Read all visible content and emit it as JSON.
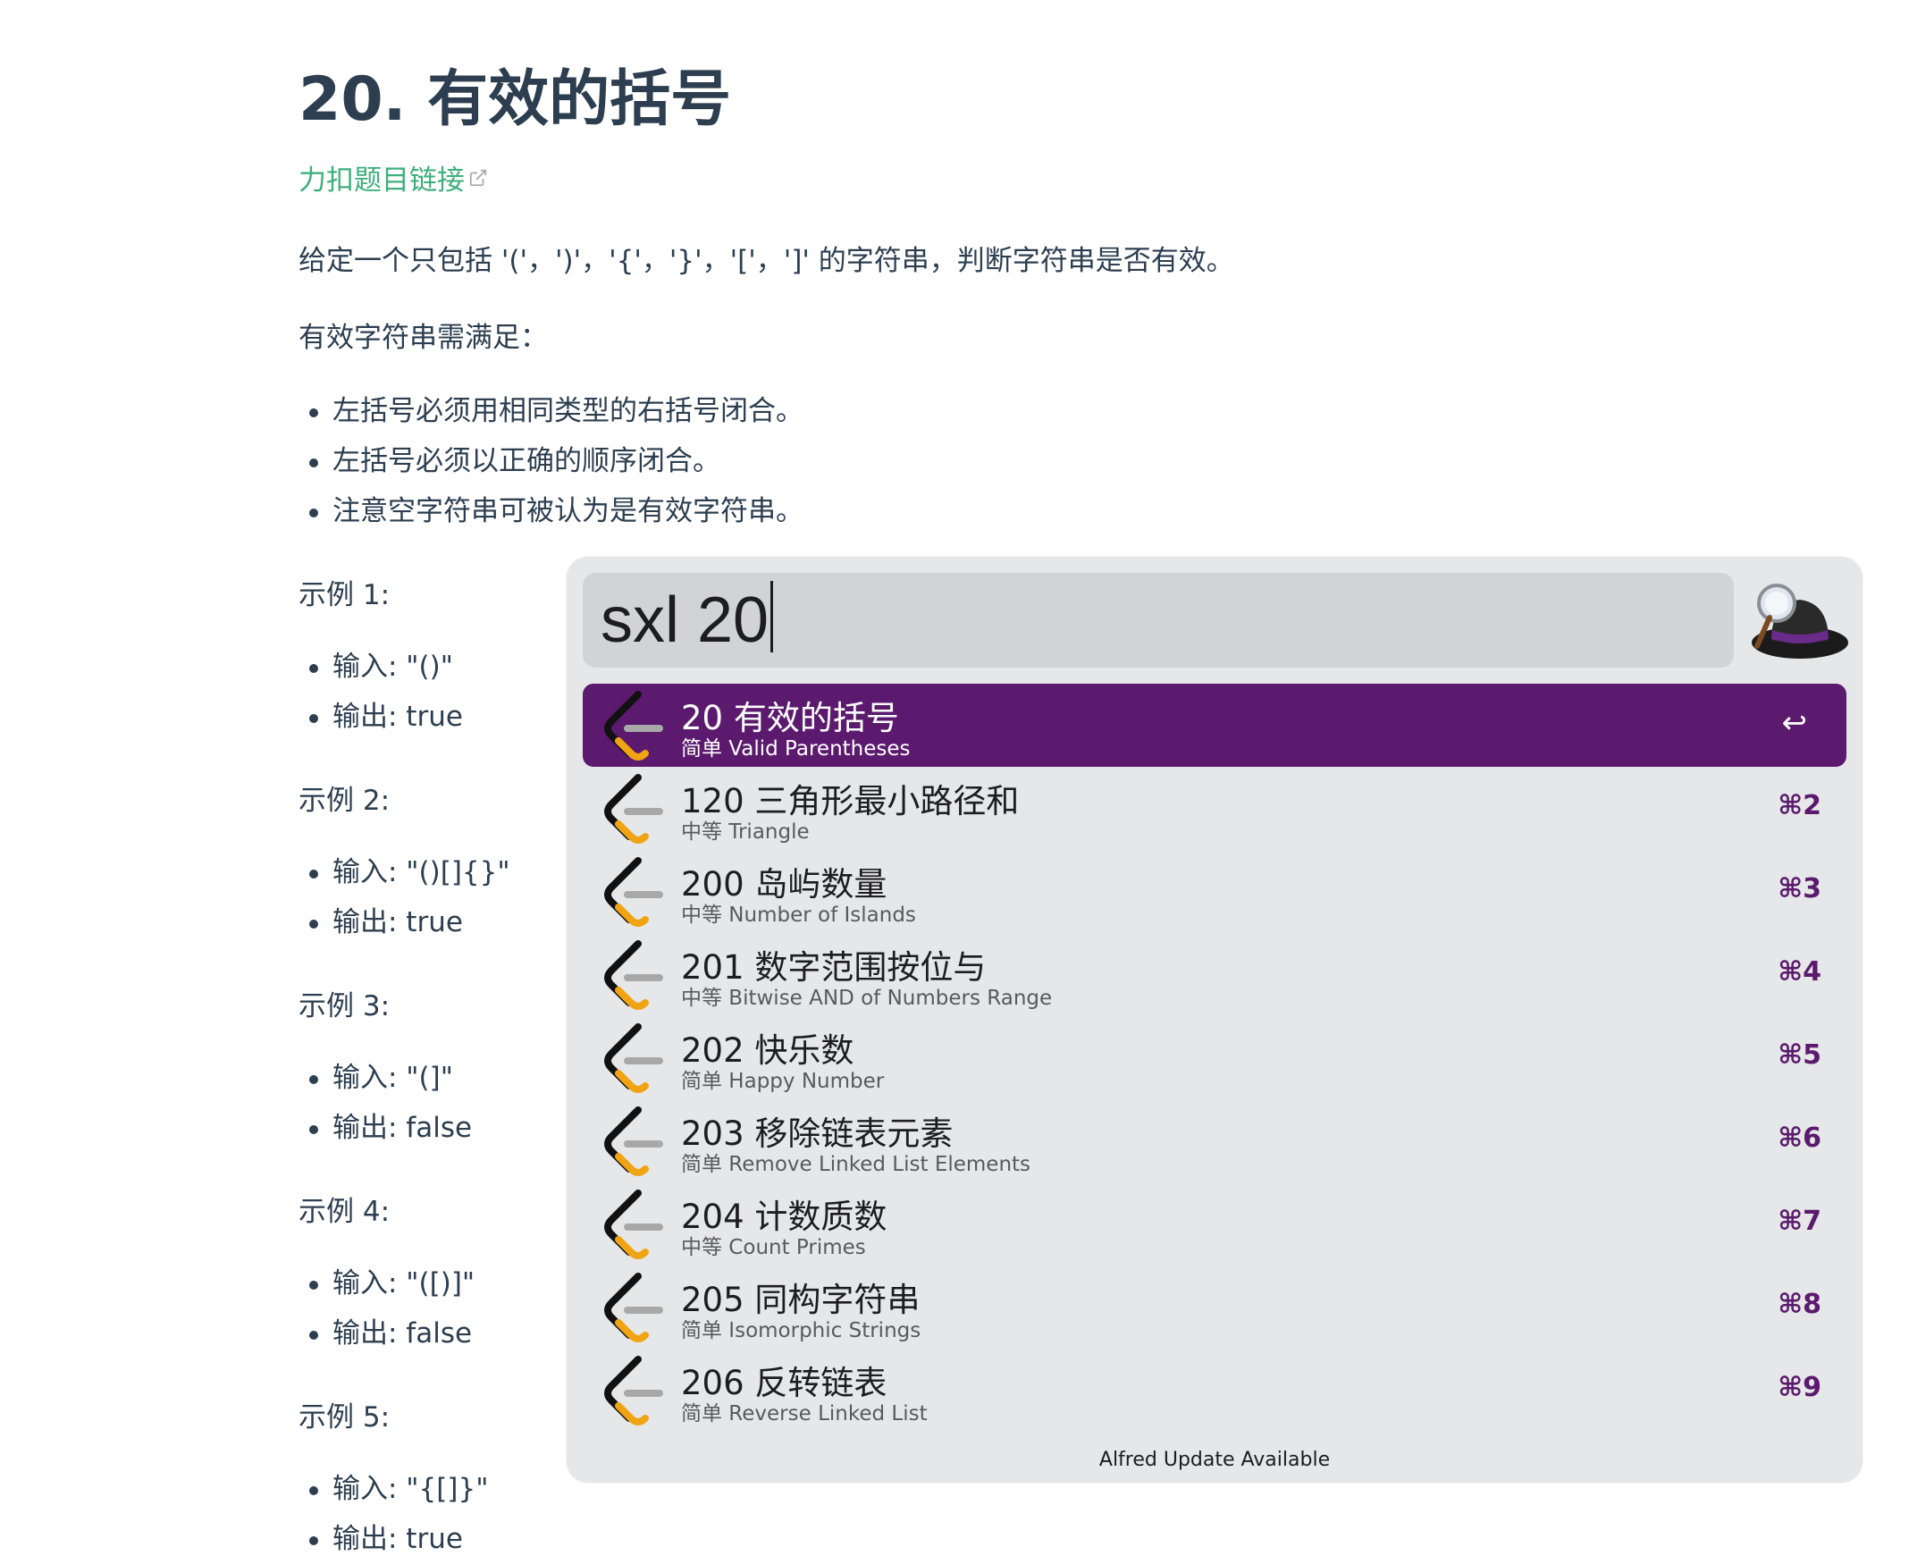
{
  "article": {
    "title": "20. 有效的括号",
    "link_text": "力扣题目链接",
    "description": "给定一个只包括 '('，')'，'{'，'}'，'['，']' 的字符串，判断字符串是否有效。",
    "requirement_intro": "有效字符串需满足：",
    "rules": [
      "左括号必须用相同类型的右括号闭合。",
      "左括号必须以正确的顺序闭合。",
      "注意空字符串可被认为是有效字符串。"
    ],
    "examples": [
      {
        "label": "示例 1:",
        "input": "输入: \"()\"",
        "output": "输出: true"
      },
      {
        "label": "示例 2:",
        "input": "输入: \"()[]{}\"",
        "output": "输出: true"
      },
      {
        "label": "示例 3:",
        "input": "输入: \"(]\"",
        "output": "输出: false"
      },
      {
        "label": "示例 4:",
        "input": "输入: \"([)]\"",
        "output": "输出: false"
      },
      {
        "label": "示例 5:",
        "input": "输入: \"{[]}\"",
        "output": "输出: true"
      }
    ]
  },
  "alfred": {
    "query": "sxl 20",
    "results": [
      {
        "title": "20 有效的括号",
        "subtitle": "简单 Valid Parentheses",
        "shortcut": "↩",
        "selected": true
      },
      {
        "title": "120 三角形最小路径和",
        "subtitle": "中等 Triangle",
        "shortcut": "⌘2"
      },
      {
        "title": "200 岛屿数量",
        "subtitle": "中等 Number of Islands",
        "shortcut": "⌘3"
      },
      {
        "title": "201 数字范围按位与",
        "subtitle": "中等 Bitwise AND of Numbers Range",
        "shortcut": "⌘4"
      },
      {
        "title": "202 快乐数",
        "subtitle": "简单 Happy Number",
        "shortcut": "⌘5"
      },
      {
        "title": "203 移除链表元素",
        "subtitle": "简单 Remove Linked List Elements",
        "shortcut": "⌘6"
      },
      {
        "title": "204 计数质数",
        "subtitle": "中等 Count Primes",
        "shortcut": "⌘7"
      },
      {
        "title": "205 同构字符串",
        "subtitle": "简单 Isomorphic Strings",
        "shortcut": "⌘8"
      },
      {
        "title": "206 反转链表",
        "subtitle": "简单 Reverse Linked List",
        "shortcut": "⌘9"
      }
    ],
    "footer": "Alfred Update Available",
    "accent_color": "#5b1a6e",
    "result_icon": "leetcode-icon",
    "app_icon": "alfred-hat-icon"
  }
}
